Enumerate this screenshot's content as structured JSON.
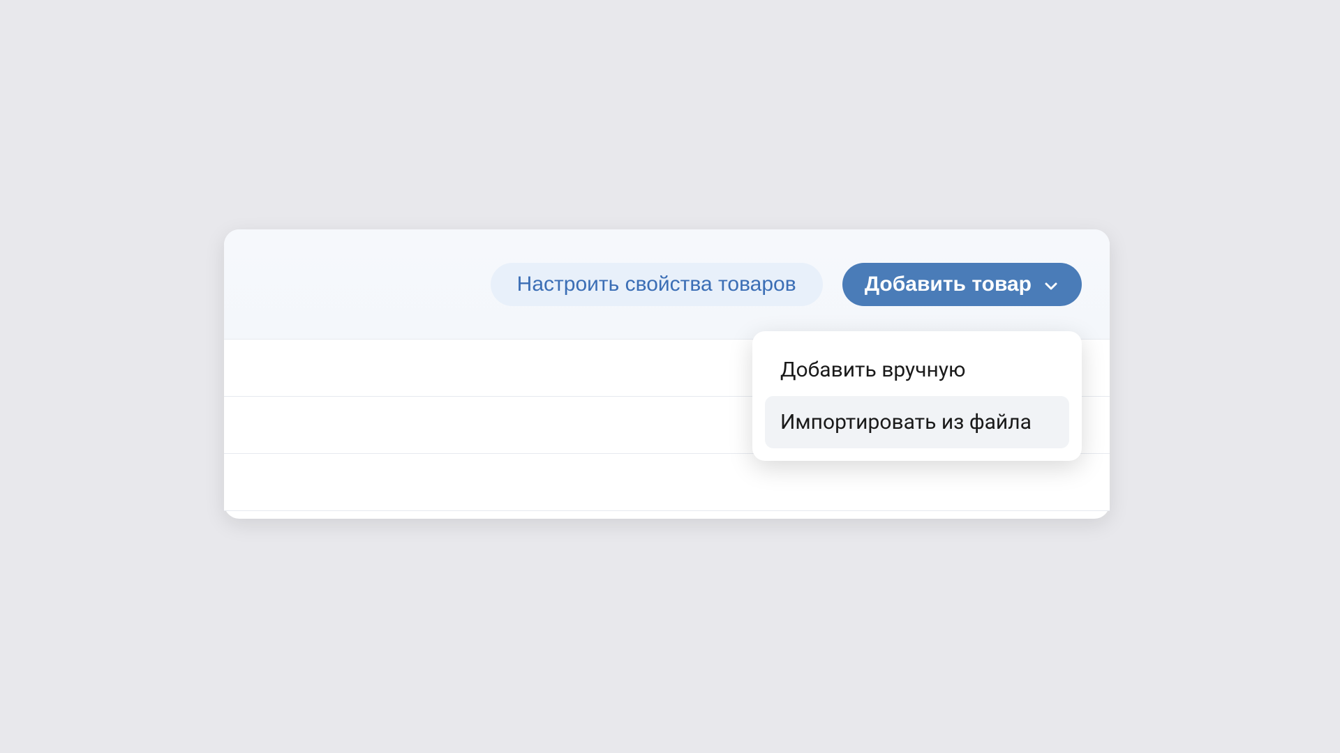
{
  "toolbar": {
    "configure_properties_label": "Настроить свойства товаров",
    "add_product_label": "Добавить товар"
  },
  "dropdown": {
    "items": [
      {
        "label": "Добавить вручную",
        "highlighted": false
      },
      {
        "label": "Импортировать из файла",
        "highlighted": true
      }
    ]
  }
}
